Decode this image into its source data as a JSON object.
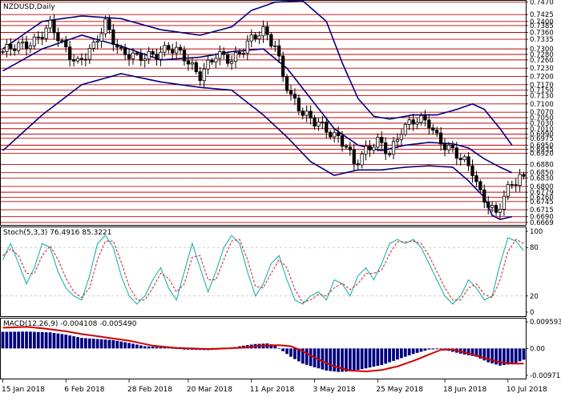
{
  "window": {
    "symbol_title": "NZDUSD,Daily",
    "stoch_title": "Stoch(5,3,3) 76.4916 85.3221",
    "macd_title": "MACD(12,26,9) -0.004108 -0.005490"
  },
  "colors": {
    "background": "#ffffff",
    "candle": "#000000",
    "bollinger": "#000080",
    "levels": "#c00000",
    "stoch_main": "#20b2aa",
    "stoch_signal": "#d03030",
    "stoch_levels": "#c0c0c0",
    "macd_hist": "#000080",
    "macd_signal": "#d00000"
  },
  "chart_data": [
    {
      "type": "candlestick",
      "name": "price",
      "ylim": [
        0.666,
        0.7475
      ],
      "price_axis_labels": [
        "0.7470",
        "0.7425",
        "0.7400",
        "0.7385",
        "0.7360",
        "0.7335",
        "0.7300",
        "0.7280",
        "0.7260",
        "0.7230",
        "0.7200",
        "0.7170",
        "0.7150",
        "0.7130",
        "0.7100",
        "0.7070",
        "0.7050",
        "0.7030",
        "0.7010",
        "0.6990",
        "0.6975",
        "0.6950",
        "0.6935",
        "0.6920",
        "0.6880",
        "0.6850",
        "0.6830",
        "0.6800",
        "0.6779",
        "0.6760",
        "0.6745",
        "0.6715",
        "0.6690",
        "0.6669"
      ],
      "levels": [
        0.747,
        0.7425,
        0.74,
        0.7385,
        0.736,
        0.7335,
        0.73,
        0.728,
        0.726,
        0.723,
        0.72,
        0.717,
        0.715,
        0.713,
        0.71,
        0.707,
        0.705,
        0.703,
        0.701,
        0.699,
        0.6975,
        0.695,
        0.6935,
        0.692,
        0.688,
        0.685,
        0.683,
        0.68,
        0.6779,
        0.676,
        0.6745,
        0.6715,
        0.669,
        0.6669
      ],
      "current_price": 0.683,
      "x_labels": [
        "15 Jan 2018",
        "6 Feb 2018",
        "28 Feb 2018",
        "20 Mar 2018",
        "11 Apr 2018",
        "3 May 2018",
        "25 May 2018",
        "18 Jun 2018",
        "10 Jul 2018"
      ],
      "x_label_bars": [
        0,
        16,
        32,
        47,
        63,
        79,
        95,
        112,
        128
      ],
      "bars": 133,
      "close_path": [
        [
          0,
          0.729
        ],
        [
          4,
          0.7305
        ],
        [
          8,
          0.7335
        ],
        [
          12,
          0.738
        ],
        [
          15,
          0.7315
        ],
        [
          19,
          0.7255
        ],
        [
          23,
          0.73
        ],
        [
          26,
          0.7395
        ],
        [
          30,
          0.729
        ],
        [
          34,
          0.726
        ],
        [
          38,
          0.7285
        ],
        [
          42,
          0.73
        ],
        [
          46,
          0.727
        ],
        [
          50,
          0.721
        ],
        [
          54,
          0.727
        ],
        [
          58,
          0.7265
        ],
        [
          62,
          0.732
        ],
        [
          66,
          0.736
        ],
        [
          69,
          0.732
        ],
        [
          71,
          0.721
        ],
        [
          73,
          0.712
        ],
        [
          76,
          0.706
        ],
        [
          80,
          0.704
        ],
        [
          84,
          0.6975
        ],
        [
          87,
          0.6945
        ],
        [
          89,
          0.689
        ],
        [
          92,
          0.6935
        ],
        [
          95,
          0.6955
        ],
        [
          98,
          0.692
        ],
        [
          101,
          0.7015
        ],
        [
          104,
          0.7035
        ],
        [
          108,
          0.703
        ],
        [
          110,
          0.6985
        ],
        [
          113,
          0.694
        ],
        [
          116,
          0.6895
        ],
        [
          119,
          0.686
        ],
        [
          121,
          0.678
        ],
        [
          123,
          0.674
        ],
        [
          125,
          0.669
        ],
        [
          127,
          0.676
        ],
        [
          129,
          0.681
        ],
        [
          131,
          0.6845
        ],
        [
          132,
          0.683
        ]
      ],
      "bollinger_upper": [
        [
          0,
          0.73
        ],
        [
          10,
          0.74
        ],
        [
          20,
          0.742
        ],
        [
          30,
          0.741
        ],
        [
          40,
          0.737
        ],
        [
          50,
          0.735
        ],
        [
          58,
          0.738
        ],
        [
          63,
          0.744
        ],
        [
          69,
          0.747
        ],
        [
          76,
          0.7475
        ],
        [
          82,
          0.74
        ],
        [
          86,
          0.725
        ],
        [
          90,
          0.712
        ],
        [
          94,
          0.7055
        ],
        [
          98,
          0.7045
        ],
        [
          104,
          0.706
        ],
        [
          110,
          0.706
        ],
        [
          115,
          0.708
        ],
        [
          119,
          0.71
        ],
        [
          122,
          0.708
        ],
        [
          126,
          0.701
        ],
        [
          129,
          0.695
        ]
      ],
      "bollinger_middle": [
        [
          0,
          0.722
        ],
        [
          10,
          0.73
        ],
        [
          20,
          0.735
        ],
        [
          30,
          0.731
        ],
        [
          40,
          0.726
        ],
        [
          50,
          0.727
        ],
        [
          58,
          0.729
        ],
        [
          66,
          0.73
        ],
        [
          72,
          0.723
        ],
        [
          78,
          0.712
        ],
        [
          84,
          0.701
        ],
        [
          90,
          0.695
        ],
        [
          96,
          0.693
        ],
        [
          102,
          0.695
        ],
        [
          108,
          0.696
        ],
        [
          114,
          0.6955
        ],
        [
          118,
          0.694
        ],
        [
          122,
          0.69
        ],
        [
          126,
          0.687
        ],
        [
          129,
          0.685
        ]
      ],
      "bollinger_lower": [
        [
          0,
          0.693
        ],
        [
          10,
          0.706
        ],
        [
          20,
          0.717
        ],
        [
          30,
          0.721
        ],
        [
          40,
          0.718
        ],
        [
          50,
          0.716
        ],
        [
          58,
          0.715
        ],
        [
          66,
          0.706
        ],
        [
          72,
          0.698
        ],
        [
          78,
          0.689
        ],
        [
          84,
          0.684
        ],
        [
          90,
          0.686
        ],
        [
          96,
          0.686
        ],
        [
          102,
          0.687
        ],
        [
          108,
          0.6875
        ],
        [
          114,
          0.687
        ],
        [
          118,
          0.682
        ],
        [
          122,
          0.676
        ],
        [
          124,
          0.6695
        ],
        [
          126,
          0.668
        ],
        [
          129,
          0.669
        ]
      ]
    },
    {
      "type": "line",
      "name": "stochastic",
      "ylim": [
        -5,
        105
      ],
      "axis_labels": [
        "100",
        "80",
        "20",
        "0"
      ],
      "axis_values": [
        100,
        80,
        20,
        0
      ],
      "main": [
        [
          0,
          65
        ],
        [
          2,
          85
        ],
        [
          4,
          60
        ],
        [
          6,
          35
        ],
        [
          8,
          55
        ],
        [
          10,
          85
        ],
        [
          12,
          80
        ],
        [
          14,
          50
        ],
        [
          16,
          30
        ],
        [
          18,
          20
        ],
        [
          20,
          15
        ],
        [
          22,
          45
        ],
        [
          24,
          85
        ],
        [
          26,
          95
        ],
        [
          28,
          80
        ],
        [
          30,
          45
        ],
        [
          32,
          20
        ],
        [
          34,
          10
        ],
        [
          36,
          20
        ],
        [
          38,
          40
        ],
        [
          40,
          55
        ],
        [
          42,
          30
        ],
        [
          44,
          15
        ],
        [
          46,
          50
        ],
        [
          48,
          85
        ],
        [
          50,
          55
        ],
        [
          52,
          25
        ],
        [
          54,
          50
        ],
        [
          56,
          80
        ],
        [
          58,
          95
        ],
        [
          60,
          85
        ],
        [
          62,
          50
        ],
        [
          64,
          20
        ],
        [
          66,
          35
        ],
        [
          68,
          60
        ],
        [
          70,
          70
        ],
        [
          72,
          40
        ],
        [
          74,
          15
        ],
        [
          76,
          10
        ],
        [
          78,
          20
        ],
        [
          80,
          25
        ],
        [
          82,
          15
        ],
        [
          84,
          40
        ],
        [
          86,
          35
        ],
        [
          88,
          20
        ],
        [
          90,
          45
        ],
        [
          92,
          55
        ],
        [
          94,
          40
        ],
        [
          96,
          60
        ],
        [
          98,
          85
        ],
        [
          100,
          90
        ],
        [
          102,
          85
        ],
        [
          104,
          90
        ],
        [
          106,
          80
        ],
        [
          108,
          60
        ],
        [
          110,
          40
        ],
        [
          112,
          20
        ],
        [
          114,
          10
        ],
        [
          116,
          20
        ],
        [
          118,
          40
        ],
        [
          120,
          30
        ],
        [
          122,
          15
        ],
        [
          124,
          20
        ],
        [
          126,
          60
        ],
        [
          128,
          92
        ],
        [
          130,
          88
        ],
        [
          132,
          76
        ]
      ],
      "signal": [
        [
          0,
          70
        ],
        [
          2,
          78
        ],
        [
          4,
          70
        ],
        [
          6,
          48
        ],
        [
          8,
          48
        ],
        [
          10,
          70
        ],
        [
          12,
          82
        ],
        [
          14,
          65
        ],
        [
          16,
          42
        ],
        [
          18,
          25
        ],
        [
          20,
          18
        ],
        [
          22,
          30
        ],
        [
          24,
          65
        ],
        [
          26,
          88
        ],
        [
          28,
          88
        ],
        [
          30,
          62
        ],
        [
          32,
          32
        ],
        [
          34,
          15
        ],
        [
          36,
          15
        ],
        [
          38,
          30
        ],
        [
          40,
          48
        ],
        [
          42,
          42
        ],
        [
          44,
          25
        ],
        [
          46,
          35
        ],
        [
          48,
          68
        ],
        [
          50,
          70
        ],
        [
          52,
          40
        ],
        [
          54,
          40
        ],
        [
          56,
          65
        ],
        [
          58,
          88
        ],
        [
          60,
          90
        ],
        [
          62,
          65
        ],
        [
          64,
          32
        ],
        [
          66,
          30
        ],
        [
          68,
          48
        ],
        [
          70,
          65
        ],
        [
          72,
          55
        ],
        [
          74,
          28
        ],
        [
          76,
          12
        ],
        [
          78,
          15
        ],
        [
          80,
          22
        ],
        [
          82,
          20
        ],
        [
          84,
          30
        ],
        [
          86,
          36
        ],
        [
          88,
          28
        ],
        [
          90,
          35
        ],
        [
          92,
          48
        ],
        [
          94,
          48
        ],
        [
          96,
          52
        ],
        [
          98,
          72
        ],
        [
          100,
          87
        ],
        [
          102,
          87
        ],
        [
          104,
          88
        ],
        [
          106,
          85
        ],
        [
          108,
          70
        ],
        [
          110,
          50
        ],
        [
          112,
          30
        ],
        [
          114,
          15
        ],
        [
          116,
          15
        ],
        [
          118,
          30
        ],
        [
          120,
          35
        ],
        [
          122,
          22
        ],
        [
          124,
          18
        ],
        [
          126,
          40
        ],
        [
          128,
          75
        ],
        [
          130,
          90
        ],
        [
          132,
          85
        ]
      ]
    },
    {
      "type": "bar",
      "name": "macd",
      "ylim": [
        -0.0109,
        0.0108
      ],
      "axis_labels": [
        "0.009593",
        "0.00",
        "-0.009712"
      ],
      "axis_values": [
        0.009593,
        0.0,
        -0.009712
      ],
      "histogram": [
        [
          0,
          0.006
        ],
        [
          6,
          0.0061
        ],
        [
          12,
          0.0058
        ],
        [
          16,
          0.005
        ],
        [
          20,
          0.0038
        ],
        [
          24,
          0.0034
        ],
        [
          28,
          0.003
        ],
        [
          32,
          0.002
        ],
        [
          36,
          0.0008
        ],
        [
          40,
          0.0005
        ],
        [
          46,
          -0.0004
        ],
        [
          52,
          -0.0006
        ],
        [
          56,
          -0.0003
        ],
        [
          60,
          0.0008
        ],
        [
          64,
          0.0016
        ],
        [
          67,
          0.0018
        ],
        [
          69,
          0.0012
        ],
        [
          71,
          -0.001
        ],
        [
          73,
          -0.003
        ],
        [
          76,
          -0.0055
        ],
        [
          79,
          -0.0068
        ],
        [
          82,
          -0.008
        ],
        [
          85,
          -0.0085
        ],
        [
          88,
          -0.0083
        ],
        [
          92,
          -0.0072
        ],
        [
          96,
          -0.006
        ],
        [
          100,
          -0.004
        ],
        [
          104,
          -0.002
        ],
        [
          108,
          -0.0004
        ],
        [
          111,
          -0.0002
        ],
        [
          114,
          -0.0012
        ],
        [
          117,
          -0.0022
        ],
        [
          120,
          -0.003
        ],
        [
          123,
          -0.005
        ],
        [
          126,
          -0.0062
        ],
        [
          128,
          -0.0058
        ],
        [
          130,
          -0.0052
        ],
        [
          132,
          -0.0041
        ]
      ],
      "signal": [
        [
          0,
          0.0075
        ],
        [
          6,
          0.0078
        ],
        [
          10,
          0.0073
        ],
        [
          16,
          0.0062
        ],
        [
          20,
          0.0052
        ],
        [
          26,
          0.004
        ],
        [
          32,
          0.0028
        ],
        [
          38,
          0.001
        ],
        [
          44,
          0.0002
        ],
        [
          52,
          -0.0002
        ],
        [
          60,
          0.0002
        ],
        [
          66,
          0.001
        ],
        [
          70,
          0.0012
        ],
        [
          73,
          0.0008
        ],
        [
          76,
          -0.001
        ],
        [
          80,
          -0.004
        ],
        [
          84,
          -0.0065
        ],
        [
          88,
          -0.008
        ],
        [
          92,
          -0.0083
        ],
        [
          96,
          -0.0078
        ],
        [
          100,
          -0.0065
        ],
        [
          104,
          -0.0045
        ],
        [
          108,
          -0.0022
        ],
        [
          111,
          -0.0005
        ],
        [
          114,
          -0.0004
        ],
        [
          118,
          -0.0018
        ],
        [
          122,
          -0.0035
        ],
        [
          126,
          -0.005
        ],
        [
          129,
          -0.0055
        ],
        [
          132,
          -0.0055
        ]
      ]
    }
  ]
}
